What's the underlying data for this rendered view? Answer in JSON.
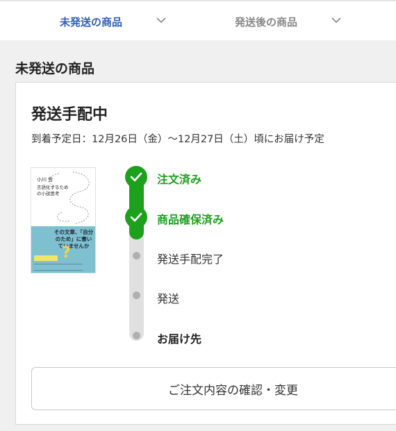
{
  "tabs": [
    {
      "label": "未発送の商品",
      "active": true,
      "icon": "chevron-down-icon"
    },
    {
      "label": "発送後の商品",
      "active": false,
      "icon": "chevron-down-icon"
    }
  ],
  "section": {
    "title": "未発送の商品"
  },
  "shipment": {
    "status": "発送手配中",
    "eta": "到着予定日：12月26日（金）〜12月27日（土）頃にお届け予定",
    "book": {
      "author": "小川 哲",
      "title": "言語化するための小説思考",
      "cover_quote": "その文章、「自分のため」に書いていませんか",
      "cover_mark": "?"
    },
    "progress": {
      "completed_steps": 2,
      "total_steps": 5
    },
    "steps": [
      {
        "label": "注文済み",
        "state": "done"
      },
      {
        "label": "商品確保済み",
        "state": "done"
      },
      {
        "label": "発送手配完了",
        "state": "pending"
      },
      {
        "label": "発送",
        "state": "pending"
      },
      {
        "label": "お届け先",
        "state": "pending"
      }
    ]
  },
  "actions": {
    "confirm_label": "ご注文内容の確認・変更"
  },
  "colors": {
    "accent_blue": "#2f5fb3",
    "success_green": "#1da11d",
    "inactive_gray": "#b0b0b0"
  }
}
